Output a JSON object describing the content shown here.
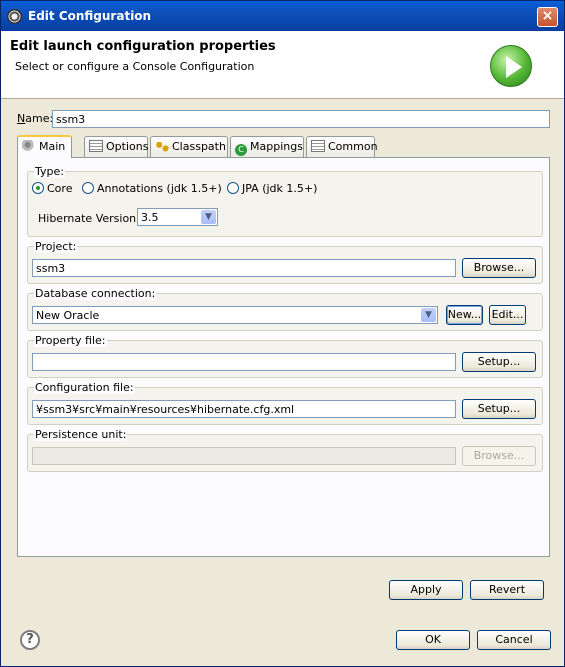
{
  "window": {
    "title": "Edit Configuration"
  },
  "header": {
    "title": "Edit launch configuration properties",
    "subtitle": "Select or configure a Console Configuration"
  },
  "name": {
    "label": "Name:",
    "value": "ssm3"
  },
  "tabs": [
    {
      "label": "Main",
      "icon": "hibernate-icon",
      "active": true
    },
    {
      "label": "Options",
      "icon": "table-icon",
      "active": false
    },
    {
      "label": "Classpath",
      "icon": "classpath-icon",
      "active": false
    },
    {
      "label": "Mappings",
      "icon": "mappings-icon",
      "active": false
    },
    {
      "label": "Common",
      "icon": "table-icon",
      "active": false
    }
  ],
  "type_group": {
    "legend": "Type:",
    "options": [
      {
        "label": "Core",
        "selected": true
      },
      {
        "label": "Annotations (jdk 1.5+)",
        "selected": false
      },
      {
        "label": "JPA (jdk 1.5+)",
        "selected": false
      }
    ],
    "version_label": "Hibernate Version:",
    "version_value": "3.5"
  },
  "project": {
    "legend": "Project:",
    "value": "ssm3",
    "button": "Browse..."
  },
  "database": {
    "legend": "Database connection:",
    "value": "New Oracle",
    "new_button": "New...",
    "edit_button": "Edit..."
  },
  "property_file": {
    "legend": "Property file:",
    "value": "",
    "button": "Setup..."
  },
  "config_file": {
    "legend": "Configuration file:",
    "value": "¥ssm3¥src¥main¥resources¥hibernate.cfg.xml",
    "button": "Setup..."
  },
  "persistence": {
    "legend": "Persistence unit:",
    "value": "",
    "button": "Browse..."
  },
  "actions": {
    "apply": "Apply",
    "revert": "Revert",
    "ok": "OK",
    "cancel": "Cancel",
    "help": "?"
  },
  "colors": {
    "titlebar": "#0a5fd8",
    "dialog_bg": "#ece9d8",
    "tab_highlight": "#ffc83c"
  }
}
